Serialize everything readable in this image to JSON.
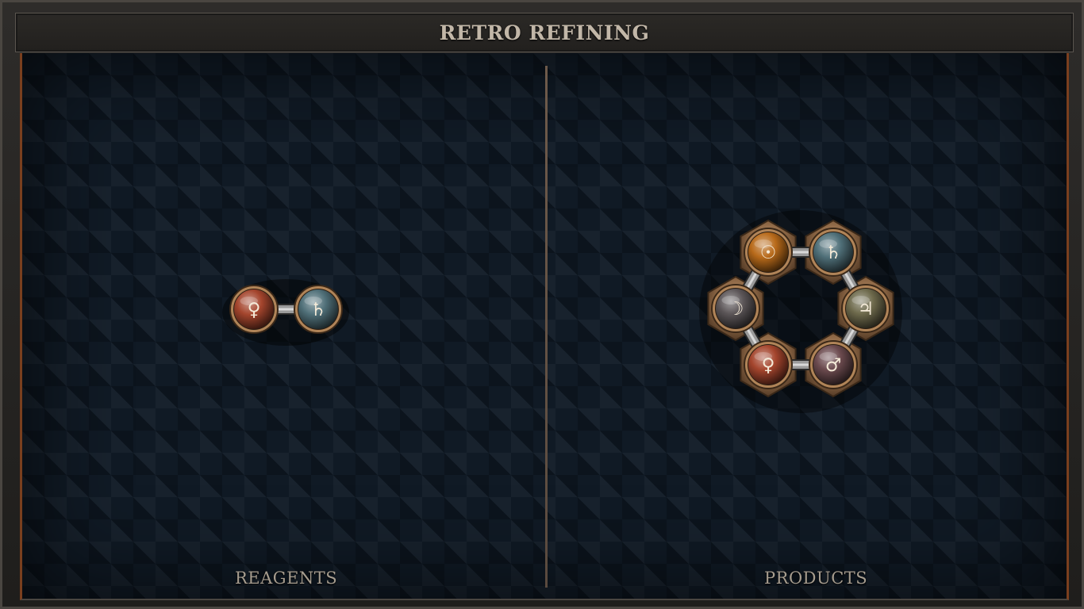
{
  "header": {
    "title": "RETRO REFINING"
  },
  "panels": {
    "reagents": {
      "label": "REAGENTS",
      "orbs": [
        {
          "symbol": "♀",
          "name": "venus",
          "color": "#a4452d"
        },
        {
          "symbol": "♄",
          "name": "saturn",
          "color": "#4f6f78"
        }
      ]
    },
    "products": {
      "label": "PRODUCTS",
      "orbs": [
        {
          "symbol": "☉",
          "name": "sun",
          "color": "#b86a1a"
        },
        {
          "symbol": "♄",
          "name": "saturn",
          "color": "#4f6f78"
        },
        {
          "symbol": "♃",
          "name": "jupiter",
          "color": "#6e6a4c"
        },
        {
          "symbol": "♂",
          "name": "mars",
          "color": "#6b4a4e"
        },
        {
          "symbol": "♀",
          "name": "venus",
          "color": "#a4452d"
        },
        {
          "symbol": "☽",
          "name": "moon",
          "color": "#5c5658"
        }
      ]
    }
  },
  "colors": {
    "frame_accent": "#7a3f1e",
    "board_background": "#101a25",
    "bronze": "#a07a55"
  }
}
